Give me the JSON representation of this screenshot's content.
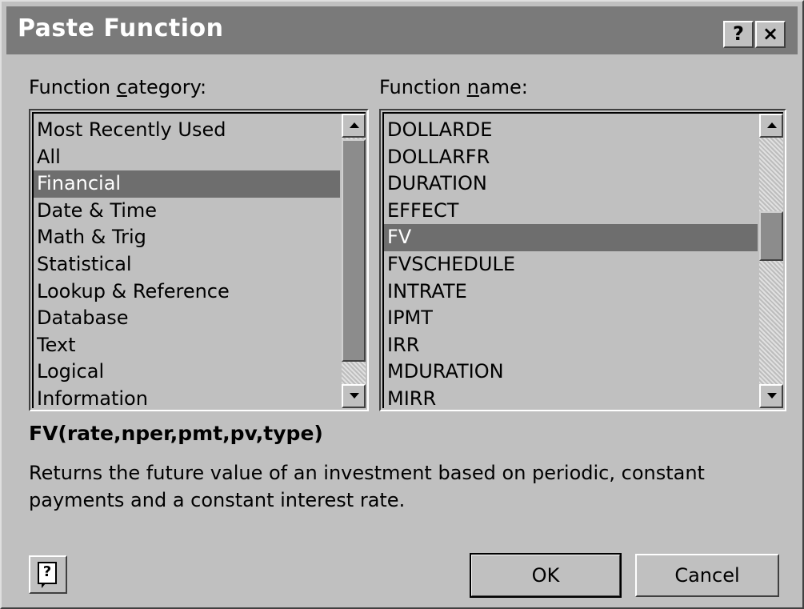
{
  "window": {
    "title": "Paste Function",
    "help_glyph": "?",
    "close_glyph": "×"
  },
  "category": {
    "label_pre": "Function ",
    "label_accel": "c",
    "label_post": "ategory:",
    "items": [
      "Most Recently Used",
      "All",
      "Financial",
      "Date & Time",
      "Math & Trig",
      "Statistical",
      "Lookup & Reference",
      "Database",
      "Text",
      "Logical",
      "Information"
    ],
    "selected": "Financial"
  },
  "function_name": {
    "label_pre": "Function ",
    "label_accel": "n",
    "label_post": "ame:",
    "items": [
      "DOLLARDE",
      "DOLLARFR",
      "DURATION",
      "EFFECT",
      "FV",
      "FVSCHEDULE",
      "INTRATE",
      "IPMT",
      "IRR",
      "MDURATION",
      "MIRR"
    ],
    "selected": "FV"
  },
  "syntax": "FV(rate,nper,pmt,pv,type)",
  "description": "Returns the future value of an investment based on periodic, constant payments and a constant interest rate.",
  "buttons": {
    "help_glyph": "?",
    "ok": "OK",
    "cancel": "Cancel"
  },
  "colors": {
    "face": "#c0c0c0",
    "titlebar": "#7a7a7a",
    "selection": "#6e6e6e"
  }
}
